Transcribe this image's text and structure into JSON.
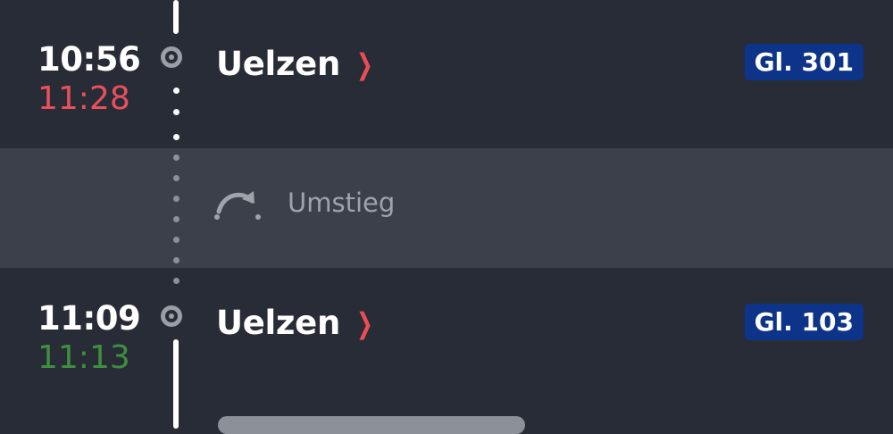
{
  "stops": [
    {
      "planned_time": "10:56",
      "actual_time": "11:28",
      "actual_status": "delayed",
      "station": "Uelzen",
      "track": "Gl. 301"
    },
    {
      "planned_time": "11:09",
      "actual_time": "11:13",
      "actual_status": "on-time",
      "station": "Uelzen",
      "track": "Gl. 103"
    }
  ],
  "transfer": {
    "label": "Umstieg",
    "icon": "transfer-arc-icon"
  },
  "station_link_icon": "chevron-right-icon",
  "colors": {
    "background": "#282c36",
    "transfer_band": "#3b404a",
    "delay_red": "#e9505c",
    "ontime_green": "#3f8f3e",
    "track_badge": "#0d3488",
    "chevron_red": "#ec4d55"
  }
}
